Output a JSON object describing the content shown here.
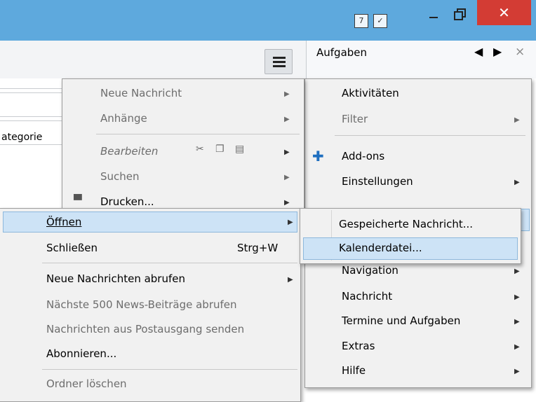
{
  "titlebar": {
    "icons": [
      "calendar-icon",
      "task-icon"
    ],
    "calendar_glyph": "7",
    "task_glyph": "✓",
    "minimize_glyph": "",
    "close_glyph": "✕",
    "accent": "#5ea9dd",
    "close_color": "#d33c34"
  },
  "today_pane": {
    "title": "Aufgaben",
    "prev": "◀",
    "next": "▶",
    "close": "×"
  },
  "background": {
    "column_label": "ategorie"
  },
  "submenu_left": {
    "items": [
      {
        "label": "Neue Nachricht",
        "arrow": "▶"
      },
      {
        "label": "Anhänge",
        "arrow": "▶"
      },
      {
        "label": "Bearbeiten",
        "arrow": "▶"
      },
      {
        "label": "Suchen",
        "arrow": "▶"
      },
      {
        "label": "Drucken...",
        "arrow": "▶"
      }
    ]
  },
  "file_menu": {
    "items": [
      {
        "label": "Öffnen",
        "arrow": "▶"
      },
      {
        "label": "Schließen",
        "shortcut": "Strg+W"
      },
      {
        "label": "Neue Nachrichten abrufen",
        "arrow": "▶"
      },
      {
        "label": "Nächste 500 News-Beiträge abrufen"
      },
      {
        "label": "Nachrichten aus Postausgang senden"
      },
      {
        "label": "Abonnieren..."
      },
      {
        "label": "Ordner löschen"
      }
    ]
  },
  "app_menu": {
    "items": [
      {
        "label": "Aktivitäten"
      },
      {
        "label": "Filter",
        "arrow": "▶"
      },
      {
        "label": "Add-ons"
      },
      {
        "label": "Einstellungen",
        "arrow": "▶"
      },
      {
        "label": "Navigation",
        "arrow": "▶"
      },
      {
        "label": "Nachricht",
        "arrow": "▶"
      },
      {
        "label": "Termine und Aufgaben",
        "arrow": "▶"
      },
      {
        "label": "Extras",
        "arrow": "▶"
      },
      {
        "label": "Hilfe",
        "arrow": "▶"
      }
    ]
  },
  "open_submenu": {
    "items": [
      {
        "label": "Gespeicherte Nachricht..."
      },
      {
        "label": "Kalenderdatei..."
      }
    ]
  }
}
